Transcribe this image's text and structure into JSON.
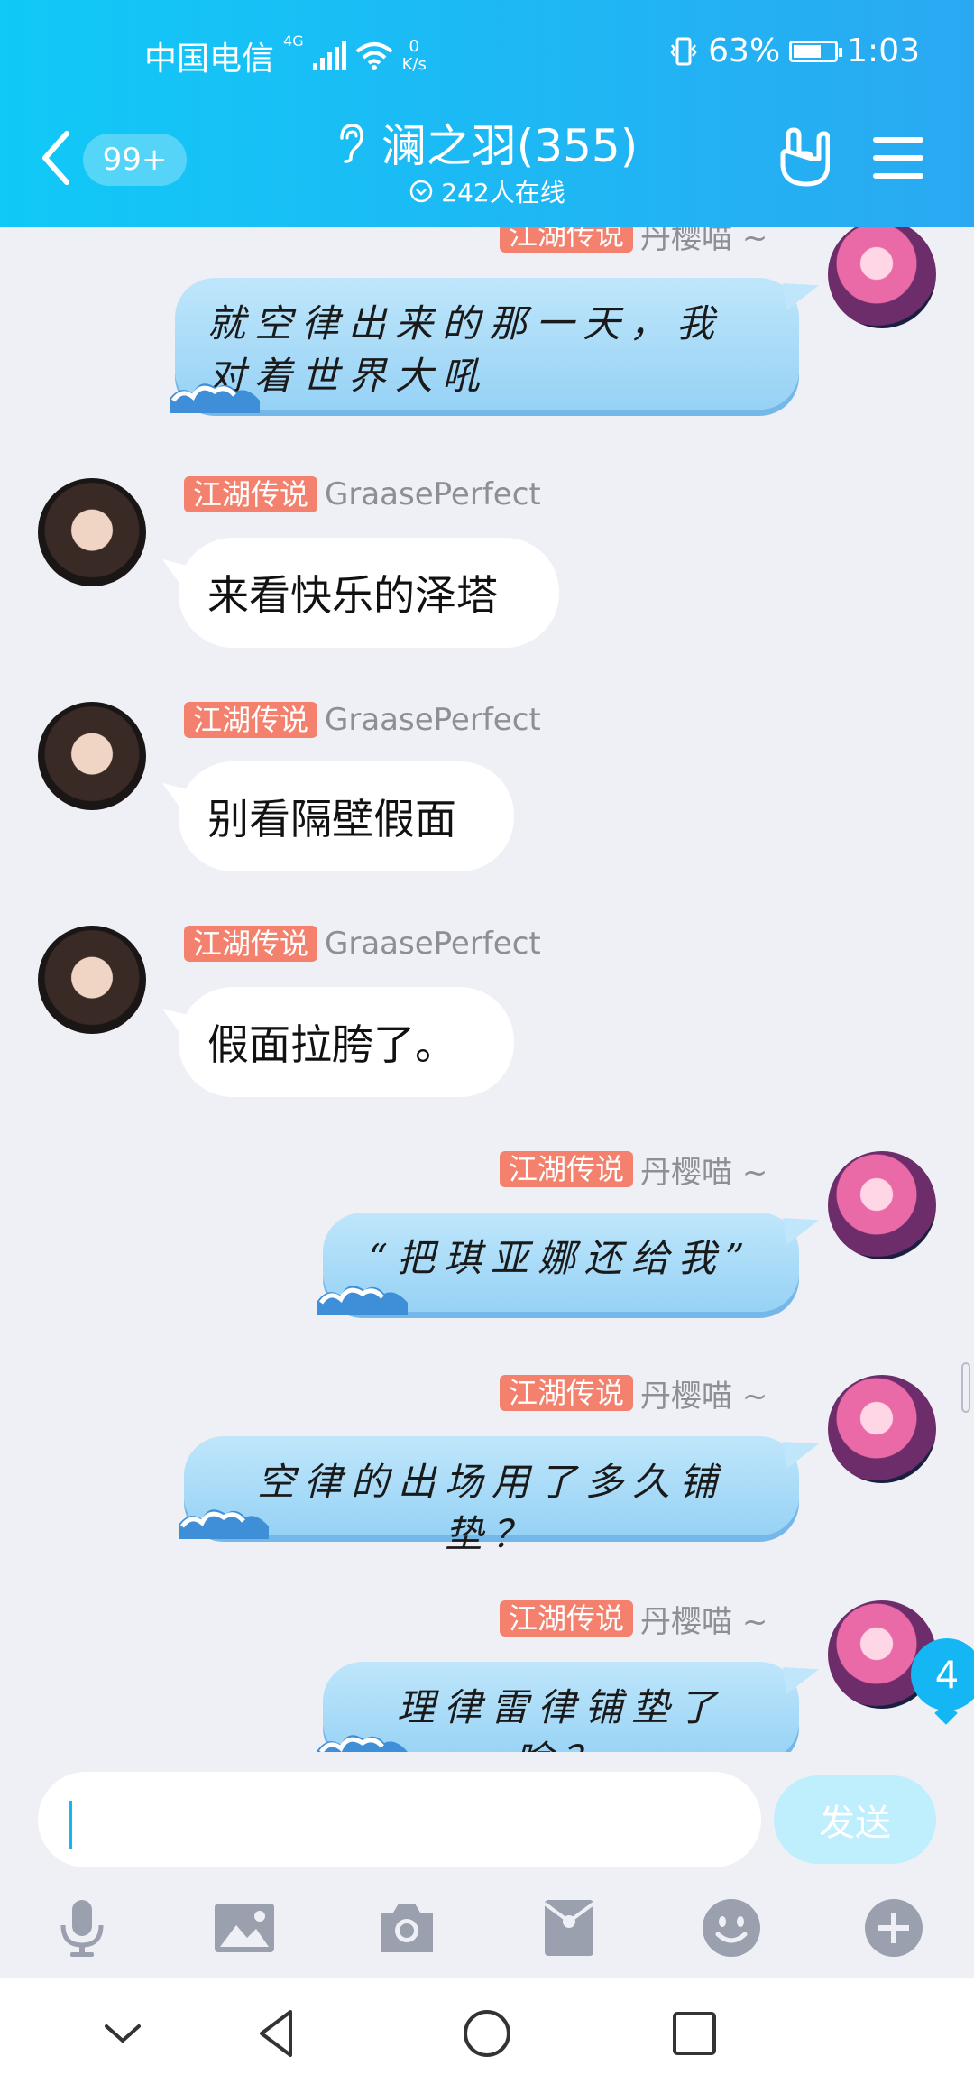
{
  "status_bar": {
    "carrier": "中国电信",
    "network": "4G",
    "speed_value": "0",
    "speed_unit": "K/s",
    "battery": "63%",
    "battery_level": 0.63,
    "time": "1:03"
  },
  "header": {
    "unread_badge": "99+",
    "group_title": "澜之羽(355)",
    "online_text": "242人在线"
  },
  "messages": [
    {
      "side": "right",
      "badge": "江湖传说",
      "nick": "丹樱喵 ~",
      "text": "就空律出来的那一天，我对着世界大吼"
    },
    {
      "side": "left",
      "badge": "江湖传说",
      "nick": "GraasePerfect",
      "text": "来看快乐的泽塔"
    },
    {
      "side": "left",
      "badge": "江湖传说",
      "nick": "GraasePerfect",
      "text": "别看隔壁假面"
    },
    {
      "side": "left",
      "badge": "江湖传说",
      "nick": "GraasePerfect",
      "text": "假面拉胯了。"
    },
    {
      "side": "right",
      "badge": "江湖传说",
      "nick": "丹樱喵 ~",
      "text": "“把琪亚娜还给我”"
    },
    {
      "side": "right",
      "badge": "江湖传说",
      "nick": "丹樱喵 ~",
      "text": "空律的出场用了多久铺垫？"
    },
    {
      "side": "right",
      "badge": "江湖传说",
      "nick": "丹樱喵 ~",
      "text": "理律雷律铺垫了啥？"
    }
  ],
  "new_messages_count": "4",
  "input": {
    "value": "",
    "send_label": "发送"
  },
  "toolbar_icons": [
    "microphone-icon",
    "image-icon",
    "camera-icon",
    "red-packet-icon",
    "emoji-icon",
    "plus-icon"
  ],
  "colors": {
    "header_gradient_start": "#10c9f7",
    "header_gradient_end": "#2aa9f2",
    "badge": "#f4816d",
    "accent": "#14b6f4",
    "background": "#eef0f5"
  }
}
